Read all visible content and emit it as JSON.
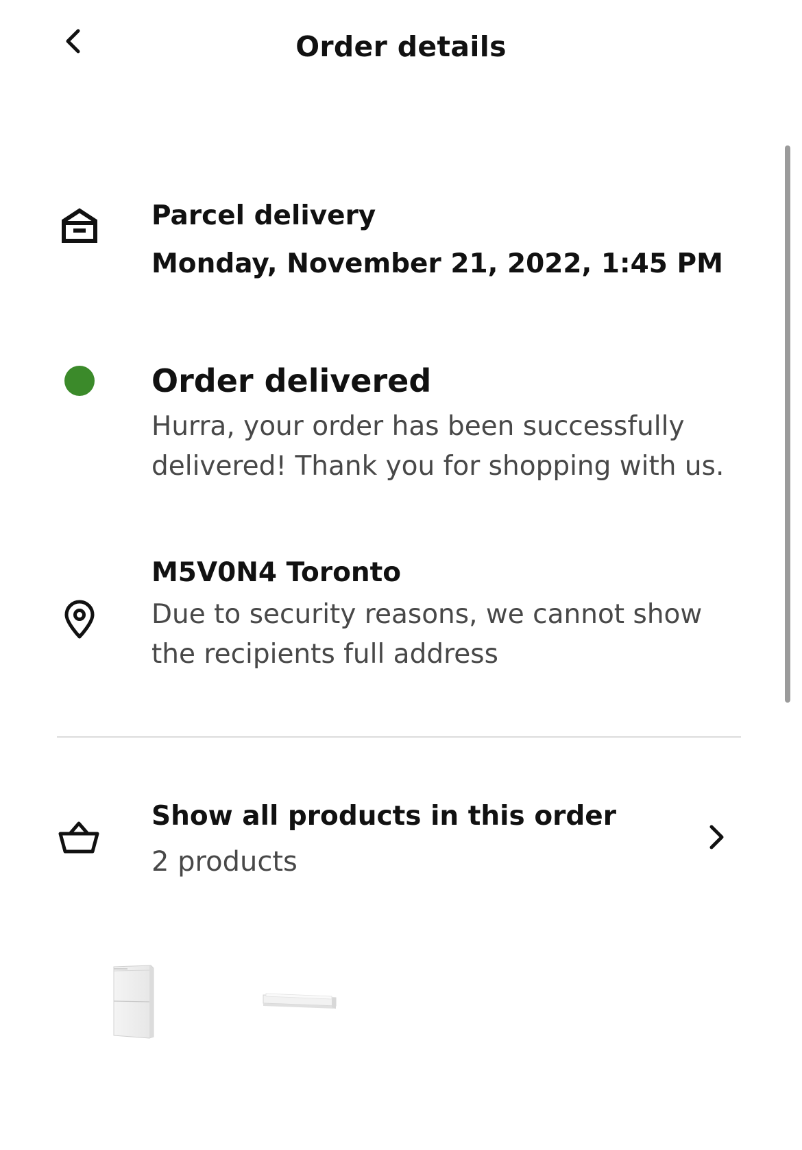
{
  "header": {
    "title": "Order details",
    "back_icon": "chevron-left-icon"
  },
  "delivery": {
    "icon": "parcel-box-icon",
    "type": "Parcel delivery",
    "datetime": "Monday, November 21, 2022, 1:45 PM"
  },
  "status": {
    "icon": "status-dot",
    "color": "#3b8a2a",
    "title": "Order delivered",
    "message": "Hurra, your order has been successfully delivered! Thank you for shopping with us."
  },
  "address": {
    "icon": "location-pin-icon",
    "location": "M5V0N4 Toronto",
    "note": "Due to security reasons, we cannot show the recipients full address"
  },
  "products": {
    "icon": "shopping-basket-icon",
    "label": "Show all products in this order",
    "count": "2 products",
    "chevron_icon": "chevron-right-icon",
    "thumbnails": [
      "shoe-cabinet-thumbnail",
      "wall-shelf-thumbnail"
    ]
  }
}
